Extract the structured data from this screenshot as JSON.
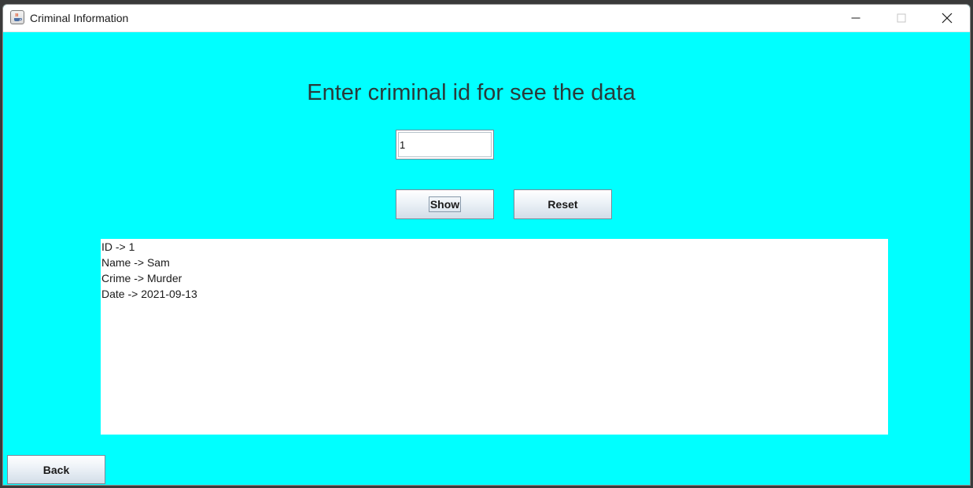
{
  "window": {
    "title": "Criminal Information"
  },
  "icons": {
    "app": "java-app-icon",
    "minimize": "minimize-icon",
    "maximize": "maximize-icon",
    "close": "close-icon"
  },
  "colors": {
    "background": "#00ffff",
    "titlebar": "#ffffff",
    "output_background": "#ffffff"
  },
  "main": {
    "heading": "Enter criminal id for see the data",
    "id_input": {
      "value": "1",
      "placeholder": ""
    },
    "show_label": "Show",
    "reset_label": "Reset",
    "back_label": "Back"
  },
  "output": {
    "lines": [
      "ID -> 1",
      "Name -> Sam",
      "Crime -> Murder",
      "Date -> 2021-09-13"
    ]
  }
}
